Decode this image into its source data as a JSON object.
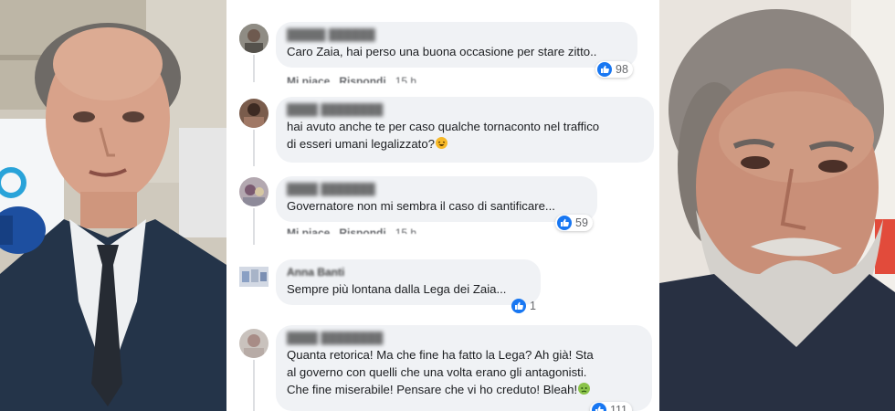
{
  "comments": [
    {
      "text": "Caro Zaia, hai perso una buona occasione per stare zitto..",
      "likes": "98",
      "actions": {
        "like": "Mi piace",
        "reply": "Rispondi",
        "time": "15 h"
      }
    },
    {
      "text": "hai avuto anche te per caso qualche tornaconto nel traffico\ndi esseri umani legalizzato?",
      "emoji": "laughing-emoji"
    },
    {
      "text": "Governatore non mi sembra il caso di santificare...",
      "likes": "59",
      "actions": {
        "like": "Mi piace",
        "reply": "Rispondi",
        "time": "15 h"
      }
    },
    {
      "author": "Anna Banti",
      "text": "Sempre più lontana dalla Lega dei Zaia...",
      "likes": "1"
    },
    {
      "text": "Quanta retorica! Ma che fine ha fatto la Lega? Ah già! Sta\nal governo con quelli che una volta erano gli antagonisti.\nChe fine miserabile! Pensare che vi ho creduto! Bleah!",
      "emoji": "nauseated-emoji",
      "likes": "111"
    }
  ],
  "colors": {
    "bubble": "#f0f2f5",
    "like_blue": "#1877f2",
    "text": "#1c1e21",
    "meta": "#65676b"
  }
}
